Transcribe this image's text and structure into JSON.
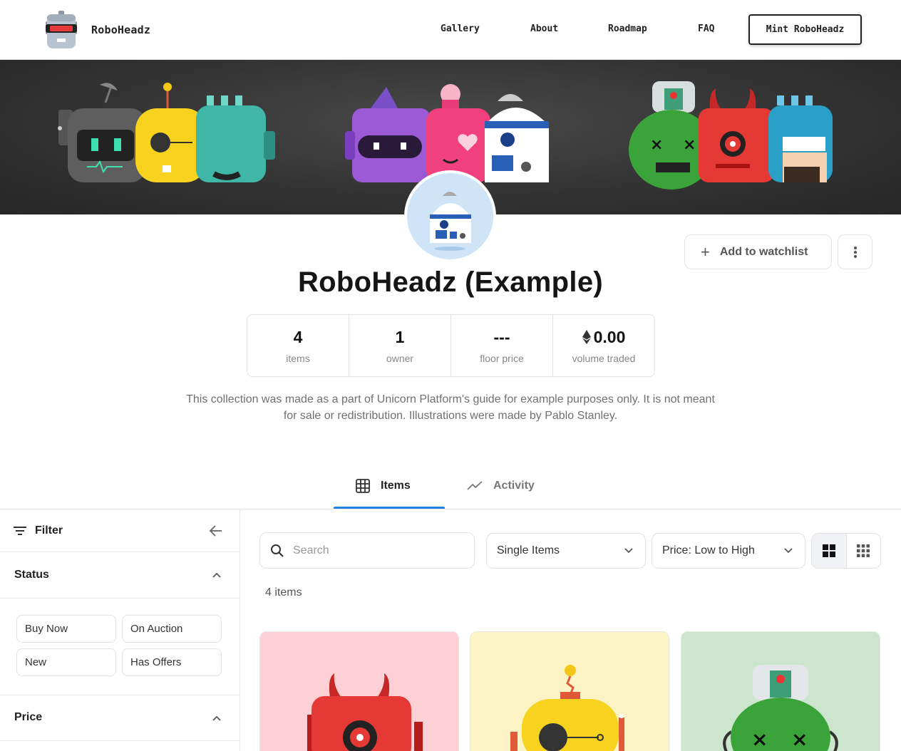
{
  "nav": {
    "brand": "RoboHeadz",
    "links": [
      "Gallery",
      "About",
      "Roadmap",
      "FAQ"
    ],
    "cta": "Mint RoboHeadz"
  },
  "collection": {
    "title": "RoboHeadz (Example)",
    "watchlist_label": "Add to watchlist",
    "stats": [
      {
        "value": "4",
        "label": "items"
      },
      {
        "value": "1",
        "label": "owner"
      },
      {
        "value": "---",
        "label": "floor price"
      },
      {
        "value": "0.00",
        "label": "volume traded"
      }
    ],
    "description": "This collection was made as a part of Unicorn Platform's guide for example purposes only. It is not meant for sale or redistribution. Illustrations were made by Pablo Stanley."
  },
  "tabs": [
    {
      "label": "Items",
      "active": true
    },
    {
      "label": "Activity",
      "active": false
    }
  ],
  "sidebar": {
    "filter_label": "Filter",
    "status_title": "Status",
    "status_options": [
      "Buy Now",
      "On Auction",
      "New",
      "Has Offers"
    ],
    "price_title": "Price"
  },
  "toolbar": {
    "search_placeholder": "Search",
    "type_select": "Single Items",
    "sort_select": "Price: Low to High"
  },
  "items_count": "4 items",
  "cards": [
    {
      "bg": "#fcd0d4",
      "robot": "red-devil"
    },
    {
      "bg": "#fdf4c6",
      "robot": "yellow-antenna"
    },
    {
      "bg": "#cce6cd",
      "robot": "green-zombie"
    }
  ],
  "colors": {
    "accent": "#2081e2",
    "text": "#151515",
    "muted": "#888888"
  }
}
